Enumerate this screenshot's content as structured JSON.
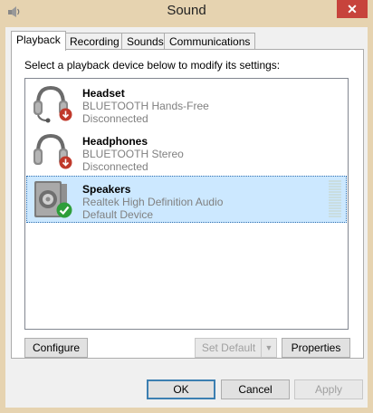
{
  "window": {
    "title": "Sound",
    "close_glyph": "✕"
  },
  "tabs": [
    {
      "label": "Playback",
      "active": true
    },
    {
      "label": "Recording",
      "active": false
    },
    {
      "label": "Sounds",
      "active": false
    },
    {
      "label": "Communications",
      "active": false
    }
  ],
  "playback": {
    "instruction": "Select a playback device below to modify its settings:",
    "devices": [
      {
        "name": "Headset",
        "driver": "BLUETOOTH Hands-Free",
        "status": "Disconnected",
        "icon": "headset-icon",
        "badge": "disconnected-badge-icon",
        "selected": false
      },
      {
        "name": "Headphones",
        "driver": "BLUETOOTH Stereo",
        "status": "Disconnected",
        "icon": "headphones-icon",
        "badge": "disconnected-badge-icon",
        "selected": false
      },
      {
        "name": "Speakers",
        "driver": "Realtek High Definition Audio",
        "status": "Default Device",
        "icon": "speaker-icon",
        "badge": "default-check-badge-icon",
        "selected": true
      }
    ],
    "buttons": {
      "configure": "Configure",
      "set_default": "Set Default",
      "properties": "Properties"
    }
  },
  "footer": {
    "ok": "OK",
    "cancel": "Cancel",
    "apply": "Apply"
  },
  "colors": {
    "title_bar": "#e6d3b0",
    "selection": "#cce8ff",
    "close": "#c7433c",
    "badge_red": "#c0392b",
    "badge_green": "#2e9e3a"
  }
}
